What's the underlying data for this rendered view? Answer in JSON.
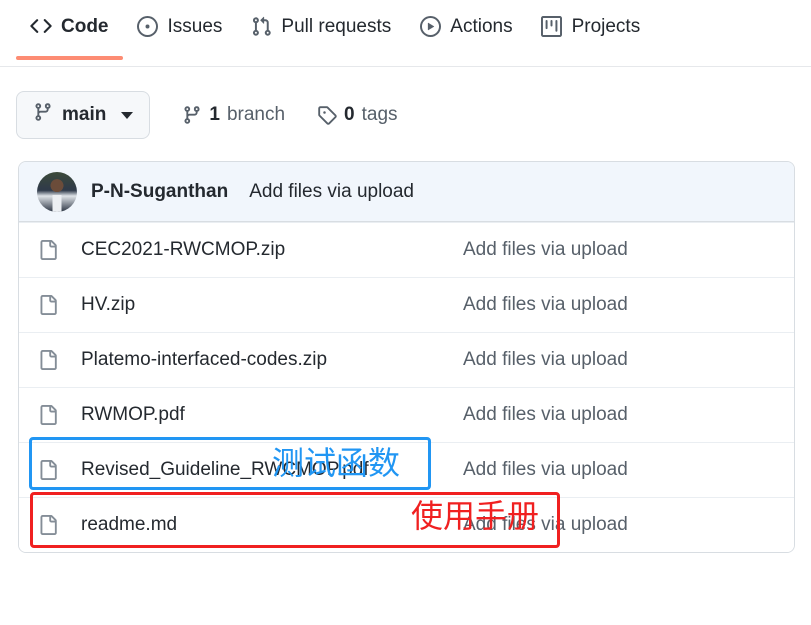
{
  "nav": {
    "tabs": [
      {
        "label": "Code",
        "icon": "code-icon",
        "selected": true
      },
      {
        "label": "Issues",
        "icon": "issue-opened-icon",
        "selected": false
      },
      {
        "label": "Pull requests",
        "icon": "git-pull-request-icon",
        "selected": false
      },
      {
        "label": "Actions",
        "icon": "play-icon",
        "selected": false
      },
      {
        "label": "Projects",
        "icon": "project-board-icon",
        "selected": false
      }
    ],
    "active_underline_color": "#fd8c73"
  },
  "toolbar": {
    "branch_name": "main",
    "branch_icon": "git-branch-icon",
    "branches_count": "1",
    "branches_label": "branch",
    "tags_count": "0",
    "tags_label": "tags",
    "tag_icon": "tag-icon"
  },
  "commit_header": {
    "author": "P-N-Suganthan",
    "message": "Add files via upload",
    "background": "#f1f6fc"
  },
  "files": [
    {
      "name": "CEC2021-RWCMOP.zip",
      "icon": "file-icon",
      "commit": "Add files via upload"
    },
    {
      "name": "HV.zip",
      "icon": "file-icon",
      "commit": "Add files via upload"
    },
    {
      "name": "Platemo-interfaced-codes.zip",
      "icon": "file-icon",
      "commit": "Add files via upload"
    },
    {
      "name": "RWMOP.pdf",
      "icon": "file-icon",
      "commit": "Add files via upload"
    },
    {
      "name": "Revised_Guideline_RWCMOP.pdf",
      "icon": "file-icon",
      "commit": "Add files via upload"
    },
    {
      "name": "readme.md",
      "icon": "file-icon",
      "commit": "Add files via upload"
    }
  ],
  "annotations": [
    {
      "text": "测试函数",
      "color": "#2196f3",
      "target": "RWMOP.pdf"
    },
    {
      "text": "使用手册",
      "color": "#f02020",
      "target": "Revised_Guideline_RWCMOP.pdf"
    }
  ]
}
